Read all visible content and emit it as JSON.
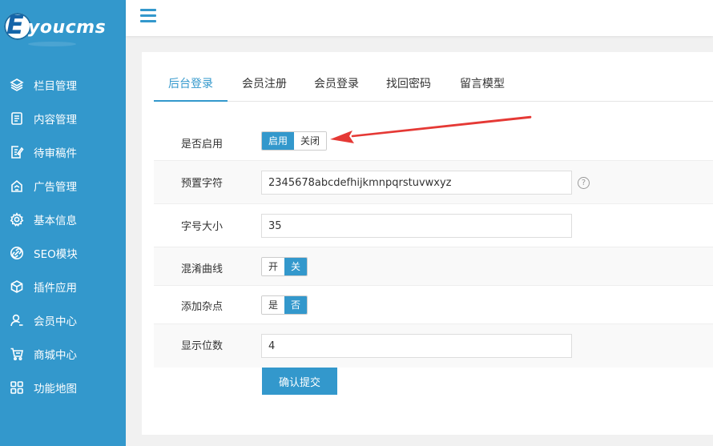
{
  "brand": {
    "logo_letter": "E",
    "logo_text": "youcms"
  },
  "colors": {
    "sidebar": "#3398cc",
    "accent": "#3398cc",
    "arrow": "#e53935"
  },
  "sidebar": {
    "items": [
      {
        "label": "栏目管理",
        "icon": "layers-icon"
      },
      {
        "label": "内容管理",
        "icon": "document-icon"
      },
      {
        "label": "待审稿件",
        "icon": "edit-document-icon"
      },
      {
        "label": "广告管理",
        "icon": "ad-icon"
      },
      {
        "label": "基本信息",
        "icon": "gear-icon"
      },
      {
        "label": "SEO模块",
        "icon": "link-icon"
      },
      {
        "label": "插件应用",
        "icon": "cube-icon"
      },
      {
        "label": "会员中心",
        "icon": "user-icon"
      },
      {
        "label": "商城中心",
        "icon": "cart-icon"
      },
      {
        "label": "功能地图",
        "icon": "grid-icon"
      }
    ]
  },
  "tabs": [
    {
      "label": "后台登录",
      "active": true
    },
    {
      "label": "会员注册",
      "active": false
    },
    {
      "label": "会员登录",
      "active": false
    },
    {
      "label": "找回密码",
      "active": false
    },
    {
      "label": "留言模型",
      "active": false
    }
  ],
  "form": {
    "enabled": {
      "label": "是否启用",
      "on": "启用",
      "off": "关闭",
      "selected": "启用"
    },
    "charset": {
      "label": "预置字符",
      "value": "2345678abcdefhijkmnpqrstuvwxyz",
      "help": "?"
    },
    "font_size": {
      "label": "字号大小",
      "value": "35"
    },
    "curve": {
      "label": "混淆曲线",
      "on": "开",
      "off": "关",
      "selected": "关"
    },
    "noise": {
      "label": "添加杂点",
      "on": "是",
      "off": "否",
      "selected": "否"
    },
    "length": {
      "label": "显示位数",
      "value": "4"
    },
    "submit_label": "确认提交"
  }
}
